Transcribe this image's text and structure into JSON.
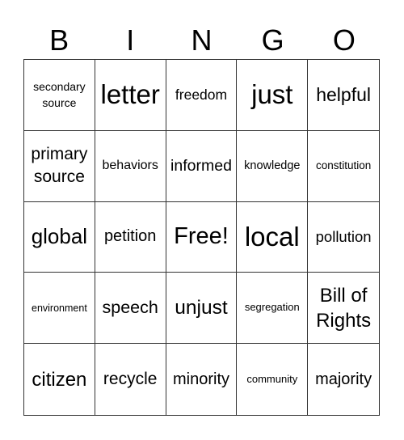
{
  "header": {
    "letters": [
      "B",
      "I",
      "N",
      "G",
      "O"
    ]
  },
  "grid": {
    "rows": [
      [
        "secondary source",
        "letter",
        "freedom",
        "just",
        "helpful"
      ],
      [
        "primary source",
        "behaviors",
        "informed",
        "knowledge",
        "constitution"
      ],
      [
        "global",
        "petition",
        "Free!",
        "local",
        "pollution"
      ],
      [
        "environment",
        "speech",
        "unjust",
        "segregation",
        "Bill of Rights"
      ],
      [
        "citizen",
        "recycle",
        "minority",
        "community",
        "majority"
      ]
    ],
    "free_space": {
      "row": 2,
      "col": 2,
      "label": "Free!"
    }
  }
}
